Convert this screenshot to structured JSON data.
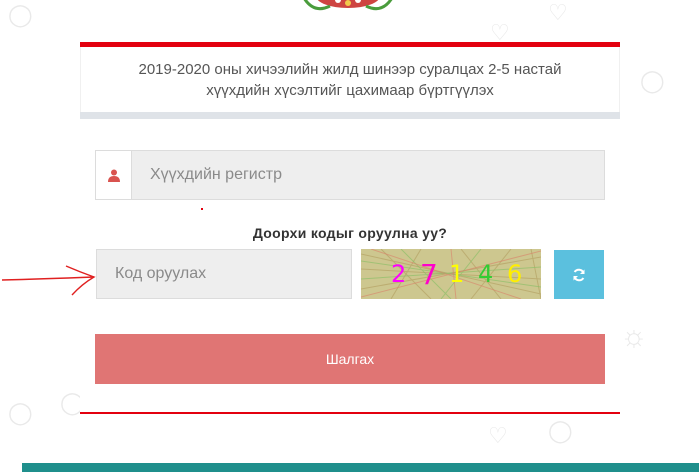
{
  "header": {
    "title_line1": "2019-2020 оны хичээлийн жилд шинээр суралцах 2-5 настай",
    "title_line2": "хүүхдийн хүсэлтийг цахимаар бүртгүүлэх"
  },
  "form": {
    "register_placeholder": "Хүүхдийн регистр",
    "user_icon": "user-icon",
    "captcha_prompt": "Доорхи кодыг оруулна уу?",
    "code_placeholder": "Код оруулах",
    "captcha_digits": [
      {
        "char": "2",
        "color": "#ff00ff"
      },
      {
        "char": "7",
        "color": "#ff00cc"
      },
      {
        "char": "1",
        "color": "#ffff00"
      },
      {
        "char": "4",
        "color": "#33cc33"
      },
      {
        "char": "6",
        "color": "#ffee00"
      }
    ],
    "refresh_icon": "refresh-icon",
    "submit_label": "Шалгах"
  },
  "colors": {
    "accent_red": "#e3000f",
    "submit_bg": "#e07574",
    "refresh_bg": "#5bc0de",
    "footer_band": "#1f8f8c"
  }
}
